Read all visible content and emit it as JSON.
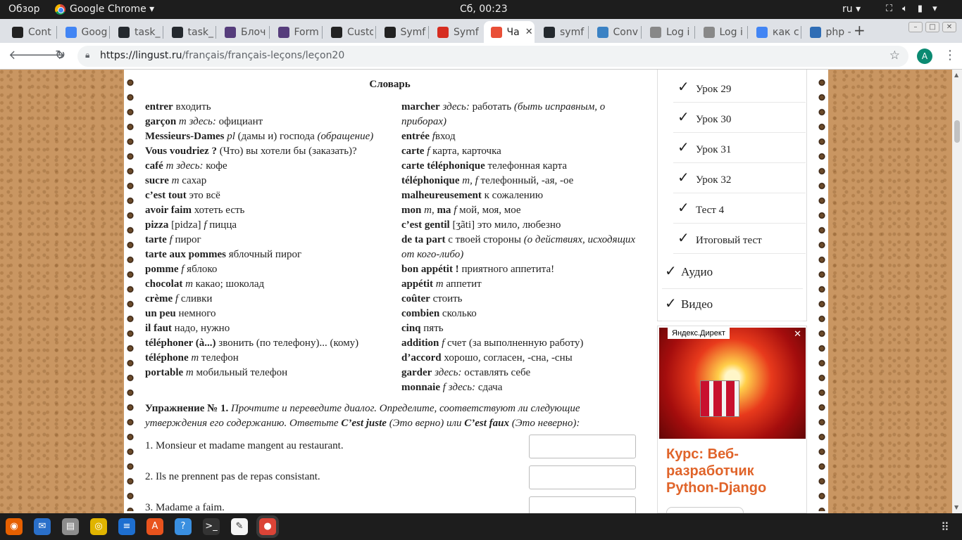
{
  "topbar": {
    "activities": "Обзор",
    "app": "Google Chrome ▾",
    "clock": "Сб, 00:23",
    "lang": "ru ▾",
    "indicators": [
      "network-icon",
      "volume-icon",
      "battery-icon",
      "power-menu-icon"
    ]
  },
  "tabs": [
    {
      "label": "Cont",
      "icon": "symfony-icon",
      "color": "#222"
    },
    {
      "label": "Goog",
      "icon": "google-translate-icon",
      "color": "#4285f4"
    },
    {
      "label": "task_",
      "icon": "github-icon",
      "color": "#24292e"
    },
    {
      "label": "task_",
      "icon": "github-icon",
      "color": "#24292e"
    },
    {
      "label": "Блоч",
      "icon": "bootstrap-icon",
      "color": "#563d7c"
    },
    {
      "label": "Form",
      "icon": "bootstrap-icon",
      "color": "#563d7c"
    },
    {
      "label": "Custo",
      "icon": "symfony-icon",
      "color": "#222"
    },
    {
      "label": "Symf",
      "icon": "symfony-icon",
      "color": "#222"
    },
    {
      "label": "Symf",
      "icon": "symfonycasts-icon",
      "color": "#d62d20"
    },
    {
      "label": "Ча",
      "icon": "pinwheel-icon",
      "color": "#e94f37",
      "active": true
    },
    {
      "label": "symf",
      "icon": "github-icon",
      "color": "#24292e"
    },
    {
      "label": "Conv",
      "icon": "chat-icon",
      "color": "#3b82c4"
    },
    {
      "label": "Log i",
      "icon": "page-icon",
      "color": "#888"
    },
    {
      "label": "Log i",
      "icon": "page-icon",
      "color": "#888"
    },
    {
      "label": "как с",
      "icon": "google-icon",
      "color": "#4285f4"
    },
    {
      "label": "php -",
      "icon": "stackoverflow-icon",
      "color": "#2f6db5"
    }
  ],
  "address": {
    "host": "https://lingust.ru",
    "path": "/français/français-leçons/leçon20",
    "profile_initial": "A"
  },
  "dictionary": {
    "title": "Словарь",
    "left": [
      {
        "fr": "entrer",
        "rest": " входить"
      },
      {
        "fr": "garçon",
        "gram": " m здесь:",
        "rest": " официант"
      },
      {
        "fr": "Messieurs-Dames",
        "gram": " pl",
        "rest": " (дамы и) господа ",
        "note": "(обращение)"
      },
      {
        "fr": "Vous voudriez ?",
        "rest": " (Что) вы хотели бы (заказать)?"
      },
      {
        "fr": "café",
        "gram": " m здесь:",
        "rest": " кофе"
      },
      {
        "fr": "sucre",
        "gram": " m",
        "rest": " сахар"
      },
      {
        "fr": "c’est tout",
        "rest": " это всё"
      },
      {
        "fr": "avoir faim",
        "rest": " хотеть есть"
      },
      {
        "fr": "pizza",
        "rest": " [pidza] ",
        "gram2": "f",
        "rest2": " пицца"
      },
      {
        "fr": "tarte",
        "gram": " f",
        "rest": " пирог"
      },
      {
        "fr": "tarte aux pommes",
        "rest": " яблочный пирог"
      },
      {
        "fr": "pomme",
        "gram": " f",
        "rest": " яблоко"
      },
      {
        "fr": "chocolat",
        "gram": " m",
        "rest": " какао; шоколад"
      },
      {
        "fr": "crème",
        "gram": " f",
        "rest": " сливки"
      },
      {
        "fr": "un peu",
        "rest": " немного"
      },
      {
        "fr": "il faut",
        "rest": " надо, нужно"
      },
      {
        "fr": "téléphoner (à...)",
        "rest": " звонить (по телефону)... (кому)"
      },
      {
        "fr": "téléphone",
        "gram": " m",
        "rest": " телефон"
      },
      {
        "fr": "portable",
        "gram": " m",
        "rest": " мобильный телефон"
      }
    ],
    "right": [
      {
        "fr": "marcher",
        "gram": " здесь:",
        "rest": " работать ",
        "note": "(быть исправным, о приборах)"
      },
      {
        "fr": "entrée",
        "gram": " f",
        "rest": "вход"
      },
      {
        "fr": "carte",
        "gram": " f",
        "rest": " карта, карточка"
      },
      {
        "fr": "carte téléphonique",
        "rest": " телефонная карта"
      },
      {
        "fr": "téléphonique",
        "gram": " m, f",
        "rest": " телефонный, -ая, -ое"
      },
      {
        "fr": "malheureusement",
        "rest": " к сожалению"
      },
      {
        "fr": "mon",
        "gram": " m",
        "rest": ", ",
        "fr2": "ma",
        "gram2": " f",
        "rest2": " мой, моя, мое"
      },
      {
        "fr": "c’est gentil",
        "rest": " [ʒãti] это мило, любезно"
      },
      {
        "fr": "de ta part",
        "rest": " с твоей стороны ",
        "note": "(о действиях, исходящих от кого-либо)"
      },
      {
        "fr": "bon appétit !",
        "rest": " приятного аппетита!"
      },
      {
        "fr": "appétit",
        "gram": " m",
        "rest": " аппетит"
      },
      {
        "fr": "coûter",
        "rest": " стоить"
      },
      {
        "fr": "combien",
        "rest": " сколько"
      },
      {
        "fr": "cinq",
        "rest": " пять"
      },
      {
        "fr": "addition",
        "gram": " f",
        "rest": " счет (за выполненную работу)"
      },
      {
        "fr": "d’accord",
        "rest": " хорошо, согласен, -сна, -сны"
      },
      {
        "fr": "garder",
        "gram": " здесь:",
        "rest": " оставлять себе"
      },
      {
        "fr": "monnaie",
        "gram": " f здесь:",
        "rest": " сдача"
      }
    ]
  },
  "exercise": {
    "label": "Упражнение № 1.",
    "instr_1": " Прочтите и переведите диалог. Определите, соответствуют ли следующие утверждения его содержанию. Ответьте ",
    "juste": "C’est juste",
    "juste_tr": " (Это верно) или ",
    "faux": "C’est faux",
    "faux_tr": " (Это неверно):",
    "questions": [
      "1. Monsieur et madame mangent au restaurant.",
      "2. Ils ne prennent pas de repas consistant.",
      "3. Madame a faim."
    ]
  },
  "sidebar": {
    "lessons": [
      "Урок 29",
      "Урок 30",
      "Урок 31",
      "Урок 32",
      "Тест 4",
      "Итоговый тест"
    ],
    "sections": [
      "Аудио",
      "Видео"
    ],
    "checkmark": "✓"
  },
  "ad": {
    "label": "Яндекс.Директ",
    "close": "✕",
    "title": "Курс: Веб-разработчик Python-Django"
  },
  "dock": [
    {
      "icon": "firefox-icon",
      "color": "#e66000"
    },
    {
      "icon": "thunderbird-icon",
      "color": "#2a6fc9"
    },
    {
      "icon": "files-icon",
      "color": "#8d8d8d"
    },
    {
      "icon": "rhythmbox-icon",
      "color": "#e0b400"
    },
    {
      "icon": "writer-icon",
      "color": "#1e6fd0"
    },
    {
      "icon": "software-icon",
      "color": "#e9531d"
    },
    {
      "icon": "help-icon",
      "color": "#3a8fe0"
    },
    {
      "icon": "terminal-icon",
      "color": "#333"
    },
    {
      "icon": "text-editor-icon",
      "color": "#f5f5f5"
    },
    {
      "icon": "chrome-icon",
      "color": "#db4437",
      "active": true
    }
  ]
}
